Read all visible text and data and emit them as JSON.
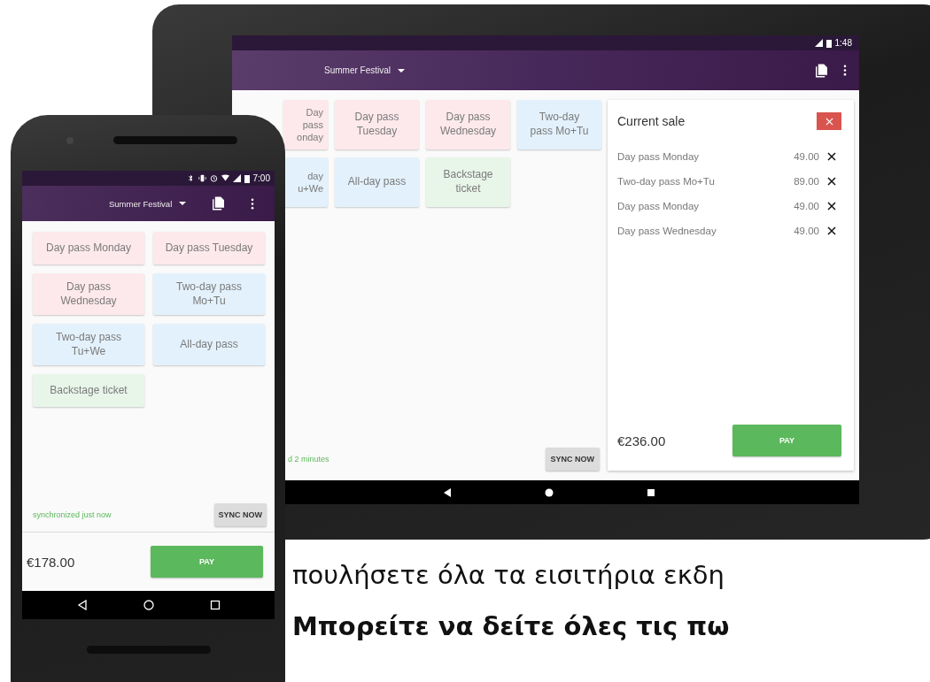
{
  "tablet": {
    "status_bar": {
      "time": "1:48"
    },
    "app_bar": {
      "event": "Summer Festival"
    },
    "products": [
      {
        "label": "Day pass\nonday",
        "color": "#fde9ec",
        "kind": "cut"
      },
      {
        "label": "Day pass\nTuesday",
        "color": "#fde9ec",
        "kind": "full"
      },
      {
        "label": "Day pass\nWednesday",
        "color": "#fde9ec",
        "kind": "full"
      },
      {
        "label": "Two-day\npass Mo+Tu",
        "color": "#e3f1fc",
        "kind": "full"
      },
      {
        "label": "day\nu+We",
        "color": "#e3f1fc",
        "kind": "cut"
      },
      {
        "label": "All-day pass",
        "color": "#e3f1fc",
        "kind": "full"
      },
      {
        "label": "Backstage\nticket",
        "color": "#e8f5e9",
        "kind": "full"
      }
    ],
    "sync": {
      "status": "d 2 minutes",
      "button": "SYNC NOW"
    },
    "sale": {
      "title": "Current sale",
      "items": [
        {
          "name": "Day pass Monday",
          "price": "49.00"
        },
        {
          "name": "Two-day pass Mo+Tu",
          "price": "89.00"
        },
        {
          "name": "Day pass Monday",
          "price": "49.00"
        },
        {
          "name": "Day pass Wednesday",
          "price": "49.00"
        }
      ],
      "total": "€236.00",
      "pay_button": "PAY"
    }
  },
  "phone": {
    "status_bar": {
      "time": "7:00"
    },
    "app_bar": {
      "event": "Summer Festival"
    },
    "products": [
      {
        "label": "Day pass Monday",
        "color": "#fde9ec"
      },
      {
        "label": "Day pass Tuesday",
        "color": "#fde9ec"
      },
      {
        "label": "Day pass\nWednesday",
        "color": "#fde9ec"
      },
      {
        "label": "Two-day pass\nMo+Tu",
        "color": "#e3f1fc"
      },
      {
        "label": "Two-day pass\nTu+We",
        "color": "#e3f1fc"
      },
      {
        "label": "All-day pass",
        "color": "#e3f1fc"
      },
      {
        "label": "Backstage ticket",
        "color": "#e8f5e9"
      }
    ],
    "sync": {
      "status": "synchronized just now",
      "button": "SYNC NOW"
    },
    "total": "€178.00",
    "pay_button": "PAY"
  },
  "caption": [
    {
      "text": "πουλήσετε όλα τα εισιτήρια εκδη",
      "bold": false
    },
    {
      "text": "Μπορείτε να δείτε όλες τις πω",
      "bold": true
    }
  ]
}
